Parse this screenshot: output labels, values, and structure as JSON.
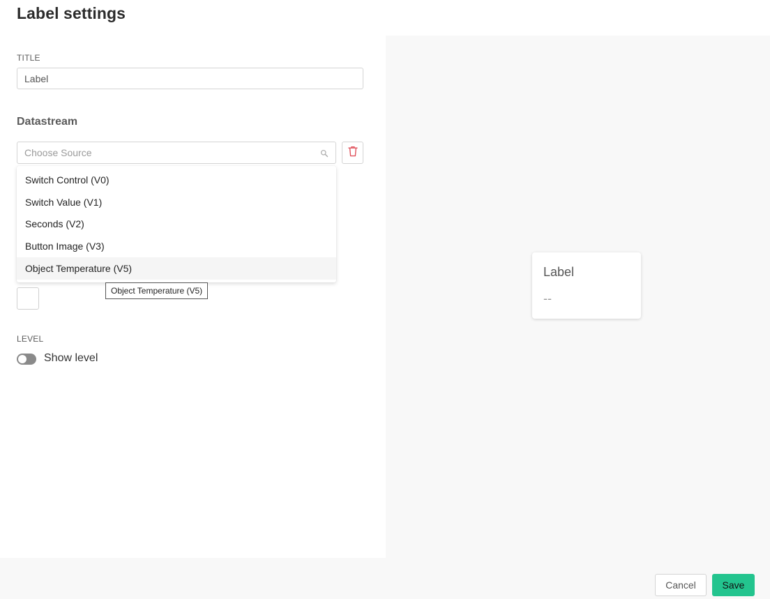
{
  "page": {
    "title": "Label settings"
  },
  "form": {
    "title_section_label": "TITLE",
    "title_value": "Label",
    "datastream_heading": "Datastream",
    "source_placeholder": "Choose Source",
    "level_section_label": "LEVEL",
    "show_level_label": "Show level",
    "show_level_on": false
  },
  "dropdown": {
    "items": [
      "Switch Control (V0)",
      "Switch Value (V1)",
      "Seconds (V2)",
      "Button Image (V3)",
      "Object Temperature (V5)"
    ],
    "hovered_index": 4,
    "tooltip": "Object Temperature (V5)"
  },
  "preview": {
    "widget_title": "Label",
    "widget_value": "--"
  },
  "footer": {
    "cancel_label": "Cancel",
    "save_label": "Save"
  },
  "colors": {
    "accent": "#23c48e",
    "delete": "#e0515b",
    "preview_bg": "#f8f8f8",
    "toggle_off": "#8a8a8a"
  },
  "icons": {
    "search": "search-icon",
    "delete": "trash-icon"
  }
}
